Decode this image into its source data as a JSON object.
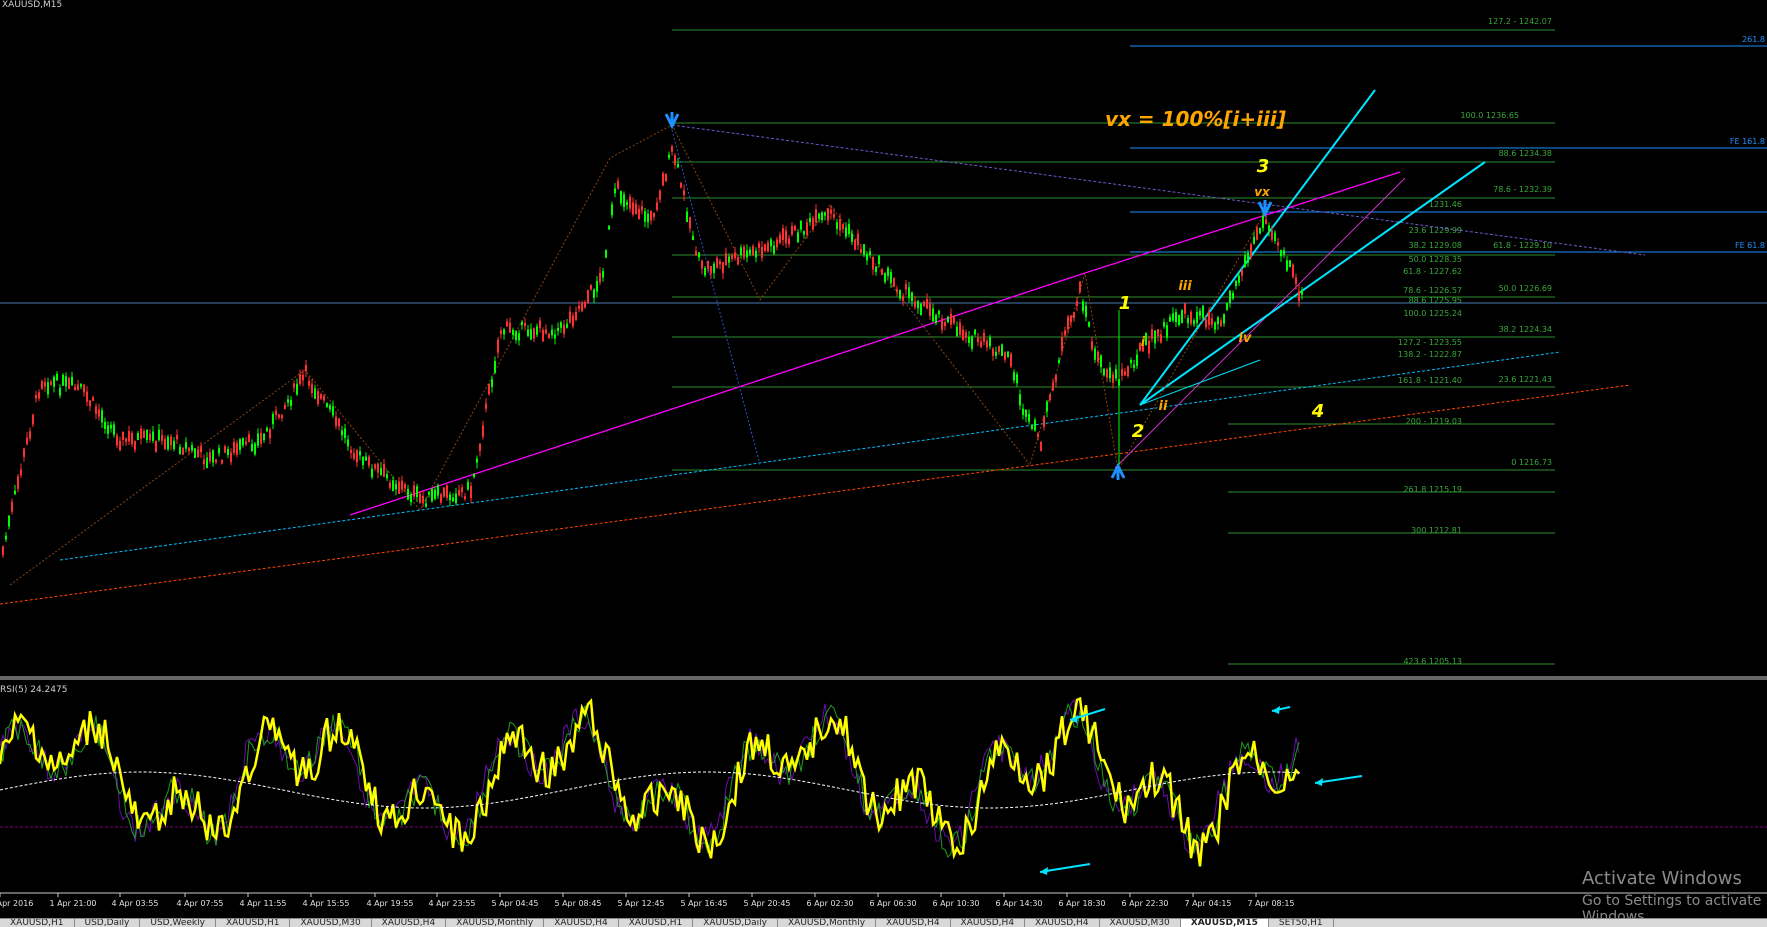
{
  "window": {
    "title": "XAUUSD,M15",
    "indicator_title": "RSI(5) 24.2475"
  },
  "annotations": {
    "formula": "vx = 100%[i+iii]",
    "wave_labels": [
      "1",
      "2",
      "3",
      "4",
      "i",
      "ii",
      "iii",
      "iv",
      "vx"
    ]
  },
  "fib_right": [
    {
      "text": "127.2 - 1242.07"
    },
    {
      "text": "100.0 1236.65"
    },
    {
      "text": "88.6 1234.38"
    },
    {
      "text": "78.6 - 1232.39"
    },
    {
      "text": "1231.46"
    },
    {
      "text": "23.6 1229.99"
    },
    {
      "text": "38.2 1229.08"
    },
    {
      "text": "61.8 - 1229.10"
    },
    {
      "text": "50.0 1228.35"
    },
    {
      "text": "61.8 - 1227.62"
    },
    {
      "text": "50.0 1226.69"
    },
    {
      "text": "78.6 - 1226.57"
    },
    {
      "text": "88.6 1225.95"
    },
    {
      "text": "100.0 1225.24"
    },
    {
      "text": "38.2 1224.34"
    },
    {
      "text": "127.2 - 1223.55"
    },
    {
      "text": "138.2 - 1222.87"
    },
    {
      "text": "161.8 - 1221.40"
    },
    {
      "text": "23.6 1221.43"
    },
    {
      "text": "200 - 1219.03"
    },
    {
      "text": "0 1216.73"
    },
    {
      "text": "261.8 1215.19"
    },
    {
      "text": "300 1212.81"
    },
    {
      "text": "423.6 1205.13"
    }
  ],
  "fe_labels": [
    {
      "text": "261.8"
    },
    {
      "text": "FE 161.8"
    },
    {
      "text": "FE 61.8"
    }
  ],
  "time_axis": [
    "Apr 2016",
    "1 Apr 21:00",
    "4 Apr 03:55",
    "4 Apr 07:55",
    "4 Apr 11:55",
    "4 Apr 15:55",
    "4 Apr 19:55",
    "4 Apr 23:55",
    "5 Apr 04:45",
    "5 Apr 08:45",
    "5 Apr 12:45",
    "5 Apr 16:45",
    "5 Apr 20:45",
    "6 Apr 02:30",
    "6 Apr 06:30",
    "6 Apr 10:30",
    "6 Apr 14:30",
    "6 Apr 18:30",
    "6 Apr 22:30",
    "7 Apr 04:15",
    "7 Apr 08:15"
  ],
  "tabs": [
    "XAUUSD,H1",
    "USD,Daily",
    "USD,Weekly",
    "XAUUSD,H1",
    "XAUUSD,M30",
    "XAUUSD,H4",
    "XAUUSD,Monthly",
    "XAUUSD,H4",
    "XAUUSD,H1",
    "XAUUSD,Daily",
    "XAUUSD,Monthly",
    "XAUUSD,H4",
    "XAUUSD,H4",
    "XAUUSD,H4",
    "XAUUSD,M30",
    "XAUUSD,M15",
    "SET50,H1"
  ],
  "active_tab": 15,
  "watermark": {
    "line1": "Activate Windows",
    "line2": "Go to Settings to activate Windows."
  },
  "colors": {
    "bull": "#00ff00",
    "bear": "#ff3030",
    "rsi": "#ffff00",
    "fib": "#2e8b2e",
    "fe": "#1e90ff",
    "channel": "#00e5ff",
    "trend": "#ff00ff",
    "label_orange": "#ffa500",
    "label_yellow": "#ffff00",
    "arrow": "#1e90ff"
  }
}
